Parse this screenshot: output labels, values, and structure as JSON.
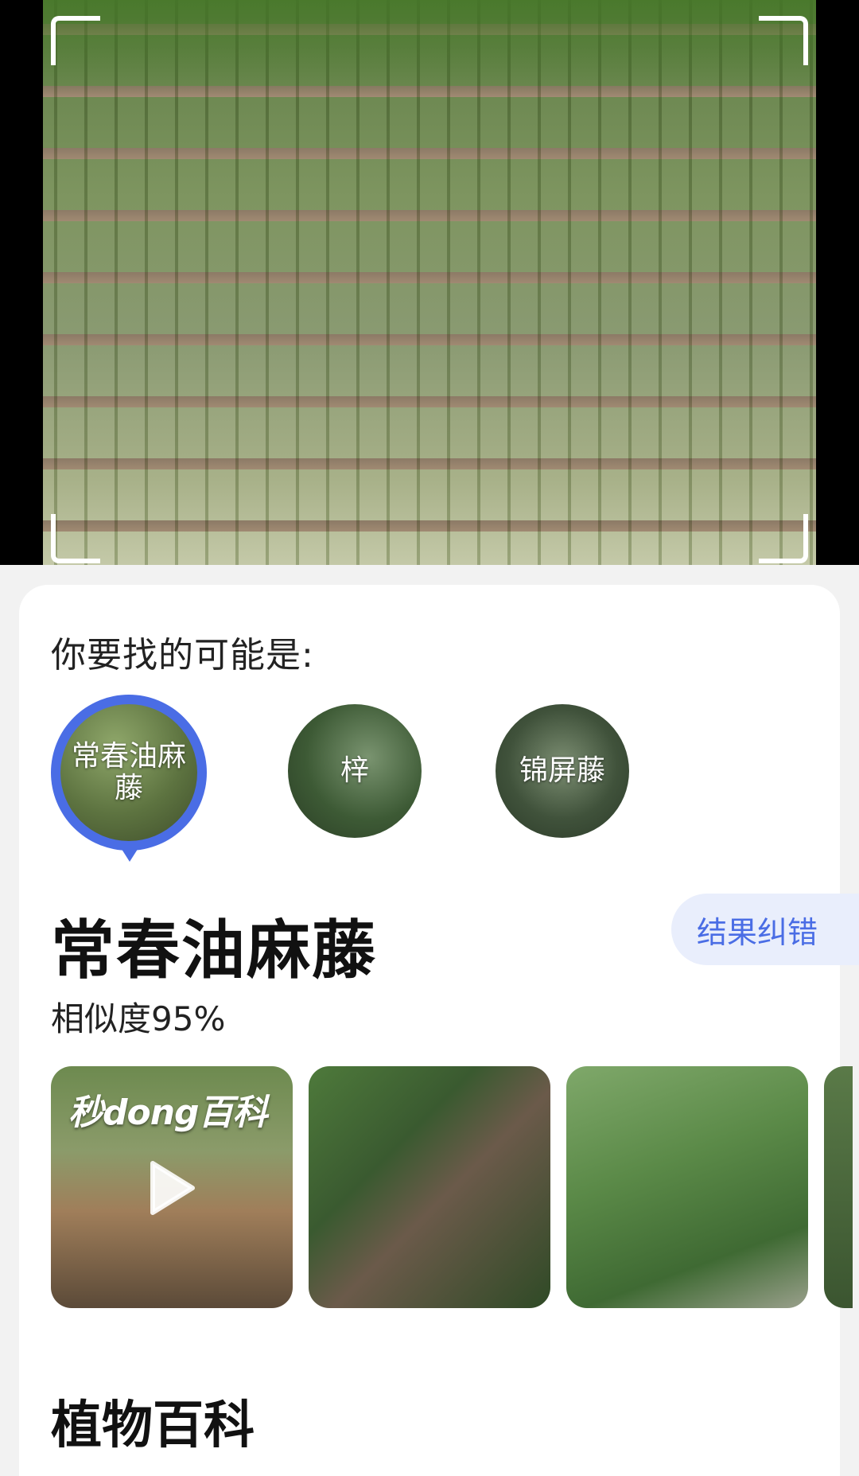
{
  "prompt": "你要找的可能是:",
  "candidates": [
    {
      "label": "常春油麻藤",
      "selected": true
    },
    {
      "label": "梓",
      "selected": false
    },
    {
      "label": "锦屏藤",
      "selected": false
    }
  ],
  "result": {
    "title": "常春油麻藤",
    "similarity": "相似度95%",
    "feedback_label": "结果纠错"
  },
  "gallery": {
    "video_watermark": "秒dong百科"
  },
  "section": {
    "title": "植物百科"
  },
  "colors": {
    "accent": "#4a6de5",
    "feedback_bg": "#e9eefc"
  }
}
